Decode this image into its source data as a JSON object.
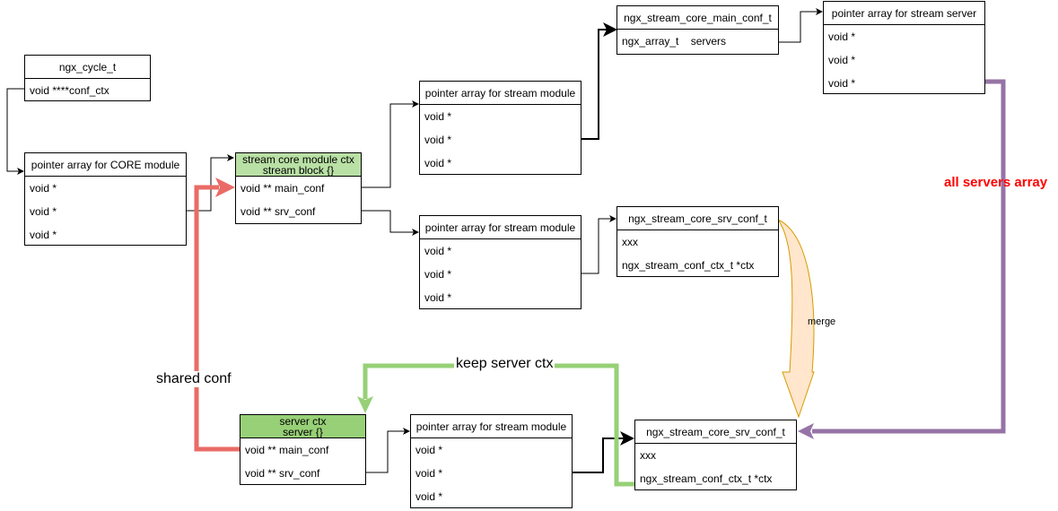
{
  "boxes": {
    "cycle": {
      "title": "ngx_cycle_t",
      "rows": [
        "void ****conf_ctx"
      ]
    },
    "core": {
      "title": "pointer array for CORE module",
      "rows": [
        "void *",
        "void *",
        "void *"
      ]
    },
    "stream_ctx": {
      "title1": "stream core module ctx",
      "title2": "stream block {}",
      "rows": [
        "void ** main_conf",
        "void ** srv_conf"
      ]
    },
    "ptr_top": {
      "title": "pointer array for stream module",
      "rows": [
        "void *",
        "void *",
        "void *"
      ]
    },
    "ptr_mid": {
      "title": "pointer array for stream module",
      "rows": [
        "void *",
        "void *",
        "void *"
      ]
    },
    "main_conf": {
      "title": "ngx_stream_core_main_conf_t",
      "rows": [
        "ngx_array_t    servers"
      ]
    },
    "ptr_server": {
      "title": "pointer array for stream server",
      "rows": [
        "void *",
        "void *",
        "void *"
      ]
    },
    "srv_conf_top": {
      "title": "ngx_stream_core_srv_conf_t",
      "rows": [
        "xxx",
        "ngx_stream_conf_ctx_t *ctx"
      ]
    },
    "server_ctx": {
      "title1": "server ctx",
      "title2": "server {}",
      "rows": [
        "void ** main_conf",
        "void ** srv_conf"
      ]
    },
    "ptr_bottom": {
      "title": "pointer array for stream module",
      "rows": [
        "void *",
        "void *",
        "void *"
      ]
    },
    "srv_conf_bottom": {
      "title": "ngx_stream_core_srv_conf_t",
      "rows": [
        "xxx",
        "ngx_stream_conf_ctx_t *ctx"
      ]
    }
  },
  "labels": {
    "all_servers": "all servers array",
    "merge": "merge",
    "shared_conf": "shared conf",
    "keep_ctx": "keep server ctx"
  },
  "colors": {
    "red": "#ea6b66",
    "green": "#97d077",
    "purple": "#9673a6",
    "merge_fill": "#ffe6cc",
    "merge_stroke": "#d79b00",
    "header_green": "#b9e0a5"
  }
}
